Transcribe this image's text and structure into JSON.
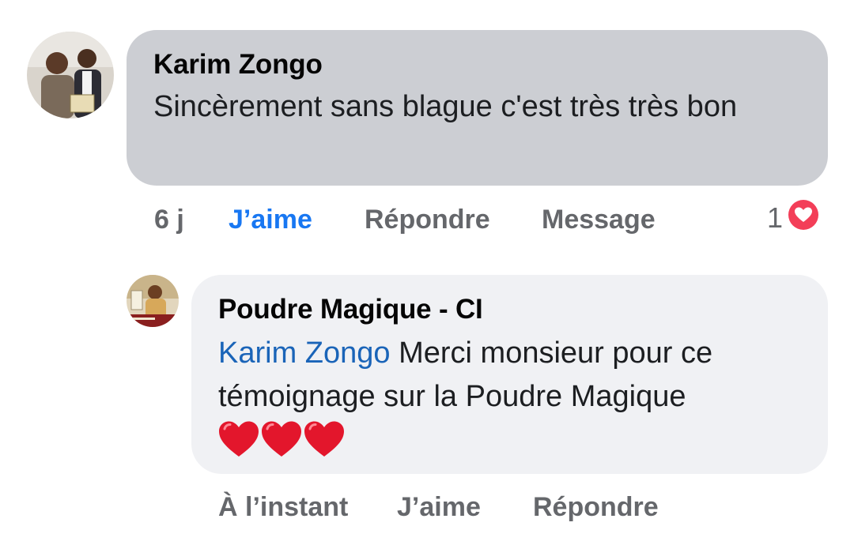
{
  "comments": [
    {
      "author": "Karim Zongo",
      "text": "Sincèrement sans blague c'est très très bon",
      "time": "6 j",
      "like_label": "J’aime",
      "reply_label": "Répondre",
      "message_label": "Message",
      "reaction_count": "1",
      "reaction_icon": "heart-reaction-icon",
      "liked": true
    },
    {
      "author": "Poudre Magique - CI",
      "mention": "Karim Zongo",
      "text": " Merci monsieur pour ce témoignage sur la Poudre Magique",
      "emoji": "❤️❤️❤️",
      "time": "À l’instant",
      "like_label": "J’aime",
      "reply_label": "Répondre"
    }
  ],
  "colors": {
    "bubble_primary": "#ccced3",
    "bubble_reply": "#f0f1f4",
    "mention": "#1a64b8",
    "liked": "#1877f2",
    "action": "#65676b",
    "heart": "#f33e58"
  }
}
